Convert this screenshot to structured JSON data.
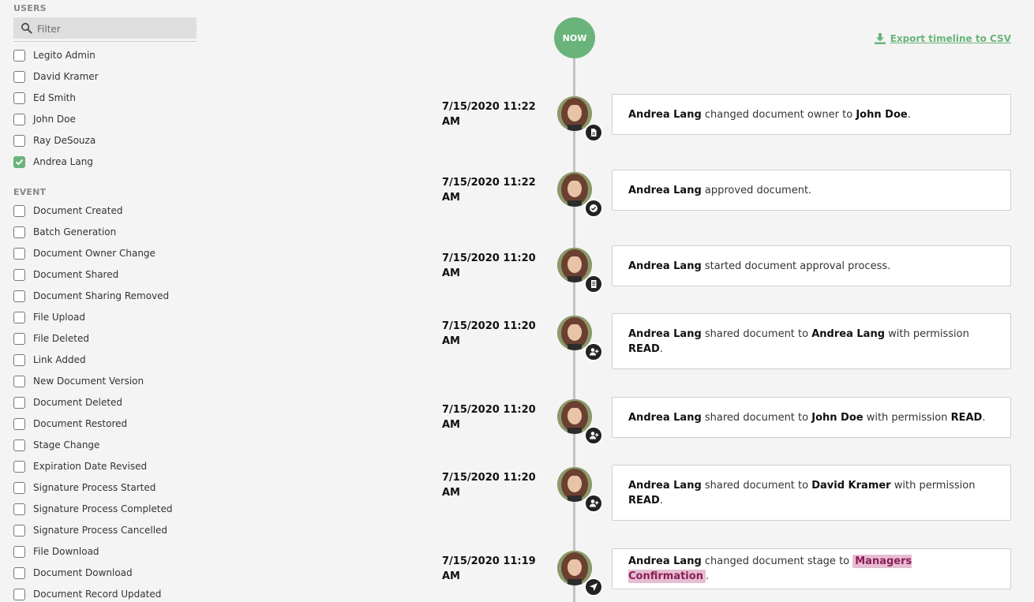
{
  "users": {
    "title": "USERS",
    "filter_placeholder": "Filter",
    "items": [
      {
        "label": "Legito Admin",
        "checked": false
      },
      {
        "label": "David Kramer",
        "checked": false
      },
      {
        "label": "Ed Smith",
        "checked": false
      },
      {
        "label": "John Doe",
        "checked": false
      },
      {
        "label": "Ray DeSouza",
        "checked": false
      },
      {
        "label": "Andrea Lang",
        "checked": true
      }
    ]
  },
  "events": {
    "title": "EVENT",
    "items": [
      {
        "label": "Document Created",
        "checked": false
      },
      {
        "label": "Batch Generation",
        "checked": false
      },
      {
        "label": "Document Owner Change",
        "checked": false
      },
      {
        "label": "Document Shared",
        "checked": false
      },
      {
        "label": "Document Sharing Removed",
        "checked": false
      },
      {
        "label": "File Upload",
        "checked": false
      },
      {
        "label": "File Deleted",
        "checked": false
      },
      {
        "label": "Link Added",
        "checked": false
      },
      {
        "label": "New Document Version",
        "checked": false
      },
      {
        "label": "Document Deleted",
        "checked": false
      },
      {
        "label": "Document Restored",
        "checked": false
      },
      {
        "label": "Stage Change",
        "checked": false
      },
      {
        "label": "Expiration Date Revised",
        "checked": false
      },
      {
        "label": "Signature Process Started",
        "checked": false
      },
      {
        "label": "Signature Process Completed",
        "checked": false
      },
      {
        "label": "Signature Process Cancelled",
        "checked": false
      },
      {
        "label": "File Download",
        "checked": false
      },
      {
        "label": "Document Download",
        "checked": false
      },
      {
        "label": "Document Record Updated",
        "checked": false
      }
    ]
  },
  "timeline": {
    "now_label": "NOW",
    "export_label": "Export timeline to CSV",
    "entries": [
      {
        "timestamp_line1": "7/15/2020 11:22",
        "timestamp_line2": "AM",
        "icon": "document-icon",
        "user": "Andrea Lang",
        "text1": " changed document owner to ",
        "target": "John Doe",
        "text2": ".",
        "permission": "",
        "stage": ""
      },
      {
        "timestamp_line1": "7/15/2020 11:22",
        "timestamp_line2": "AM",
        "icon": "check-circle-icon",
        "user": "Andrea Lang",
        "text1": " approved document.",
        "target": "",
        "text2": "",
        "permission": "",
        "stage": ""
      },
      {
        "timestamp_line1": "7/15/2020 11:20",
        "timestamp_line2": "AM",
        "icon": "list-document-icon",
        "user": "Andrea Lang",
        "text1": " started document approval process.",
        "target": "",
        "text2": "",
        "permission": "",
        "stage": ""
      },
      {
        "timestamp_line1": "7/15/2020 11:20",
        "timestamp_line2": "AM",
        "icon": "add-user-icon",
        "user": "Andrea Lang",
        "text1": " shared document to ",
        "target": "Andrea Lang",
        "text2": " with permission ",
        "permission": "READ",
        "stage": ""
      },
      {
        "timestamp_line1": "7/15/2020 11:20",
        "timestamp_line2": "AM",
        "icon": "add-user-icon",
        "user": "Andrea Lang",
        "text1": " shared document to ",
        "target": "John Doe",
        "text2": " with permission ",
        "permission": "READ",
        "stage": ""
      },
      {
        "timestamp_line1": "7/15/2020 11:20",
        "timestamp_line2": "AM",
        "icon": "add-user-icon",
        "user": "Andrea Lang",
        "text1": " shared document to ",
        "target": "David Kramer",
        "text2": " with permission ",
        "permission": "READ",
        "stage": ""
      },
      {
        "timestamp_line1": "7/15/2020 11:19",
        "timestamp_line2": "AM",
        "icon": "send-icon",
        "user": "Andrea Lang",
        "text1": " changed document stage to ",
        "target": "",
        "text2": "",
        "permission": "",
        "stage": "Managers Confirmation"
      }
    ]
  },
  "colors": {
    "accent": "#6ab47b",
    "stage_tag_bg": "#e7bdd3",
    "stage_tag_text": "#8a1f56"
  }
}
